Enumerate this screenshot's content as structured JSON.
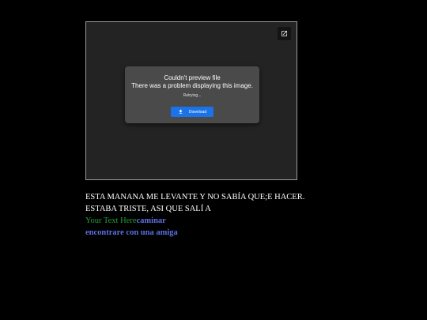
{
  "preview": {
    "open_icon": "open-in-new-icon",
    "dialog": {
      "title": "Couldn't preview file",
      "message": "There was a problem displaying this image.",
      "status": "Retrying...",
      "download_label": "Download",
      "download_icon": "download-icon"
    }
  },
  "content": {
    "line1": "ESTA MANANA ME LEVANTE Y NO SABÍA QUE;E HACER.",
    "line2": "ESTABA TRISTE, ASI QUE SALÍ A",
    "placeholder": "Your Text Here",
    "word": "caminar",
    "line4": "encontrare con una amiga"
  },
  "colors": {
    "background": "#000000",
    "frame": "#232323",
    "dialog": "#4a4a4a",
    "button": "#1a73e8",
    "green_text": "#22a034",
    "blue_text": "#5b72e6"
  }
}
